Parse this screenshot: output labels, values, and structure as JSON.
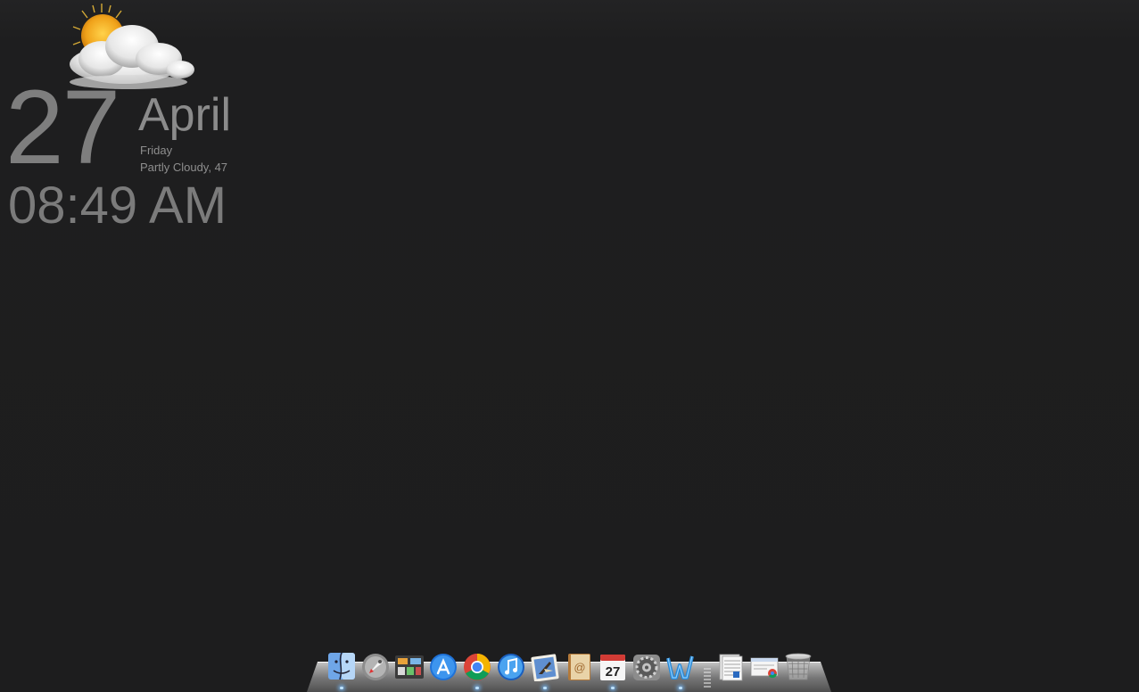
{
  "widget": {
    "weather_icon": "partly-cloudy-icon",
    "day": "27",
    "month": "April",
    "weekday": "Friday",
    "condition": "Partly Cloudy, 47",
    "time": "08:49 AM"
  },
  "dock": {
    "items": [
      {
        "name": "finder",
        "icon": "finder-icon",
        "running": true
      },
      {
        "name": "launchpad",
        "icon": "launchpad-icon",
        "running": false
      },
      {
        "name": "mission-control",
        "icon": "mission-control-icon",
        "running": false
      },
      {
        "name": "app-store",
        "icon": "app-store-icon",
        "running": false
      },
      {
        "name": "chrome",
        "icon": "chrome-icon",
        "running": true
      },
      {
        "name": "itunes",
        "icon": "itunes-icon",
        "running": false
      },
      {
        "name": "mail",
        "icon": "mail-icon",
        "running": true
      },
      {
        "name": "address-book",
        "icon": "address-book-icon",
        "running": false
      },
      {
        "name": "calendar",
        "icon": "calendar-icon",
        "running": true,
        "label": "27"
      },
      {
        "name": "system-preferences",
        "icon": "system-preferences-icon",
        "running": false
      },
      {
        "name": "word",
        "icon": "word-icon",
        "running": true
      },
      {
        "name": "documents-stack",
        "icon": "documents-stack-icon",
        "running": false
      },
      {
        "name": "downloads-stack",
        "icon": "downloads-stack-icon",
        "running": false
      },
      {
        "name": "trash",
        "icon": "trash-icon",
        "running": false
      }
    ]
  }
}
